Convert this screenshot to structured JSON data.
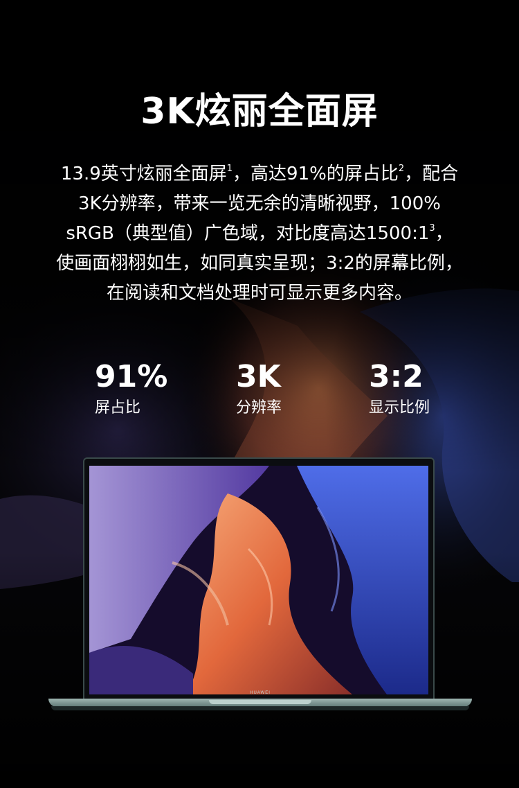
{
  "hero": {
    "title": "3K炫丽全面屏"
  },
  "description": {
    "line1_a": "13.9英寸炫丽全面屏",
    "line1_sup1": "1",
    "line1_b": "，高达91%的屏占比",
    "line1_sup2": "2",
    "line1_c": "，配合",
    "line2": "3K分辨率，带来一览无余的清晰视野，100%",
    "line3_a": "sRGB（典型值）广色域，对比度高达1500:1",
    "line3_sup": "3",
    "line3_b": "，",
    "line4": "使画面栩栩如生，如同真实呈现；3:2的屏幕比例，",
    "line5": "在阅读和文档处理时可显示更多内容。"
  },
  "stats": [
    {
      "value": "91%",
      "label": "屏占比"
    },
    {
      "value": "3K",
      "label": "分辨率"
    },
    {
      "value": "3:2",
      "label": "显示比例"
    }
  ],
  "laptop": {
    "brand": "HUAWEI"
  },
  "colors": {
    "background": "#000000",
    "text": "#ffffff",
    "rock_orange": "#e2783d",
    "rock_blue": "#3a5bd6",
    "rock_purple": "#4b2f8f",
    "laptop_frame": "#6f8a87"
  }
}
